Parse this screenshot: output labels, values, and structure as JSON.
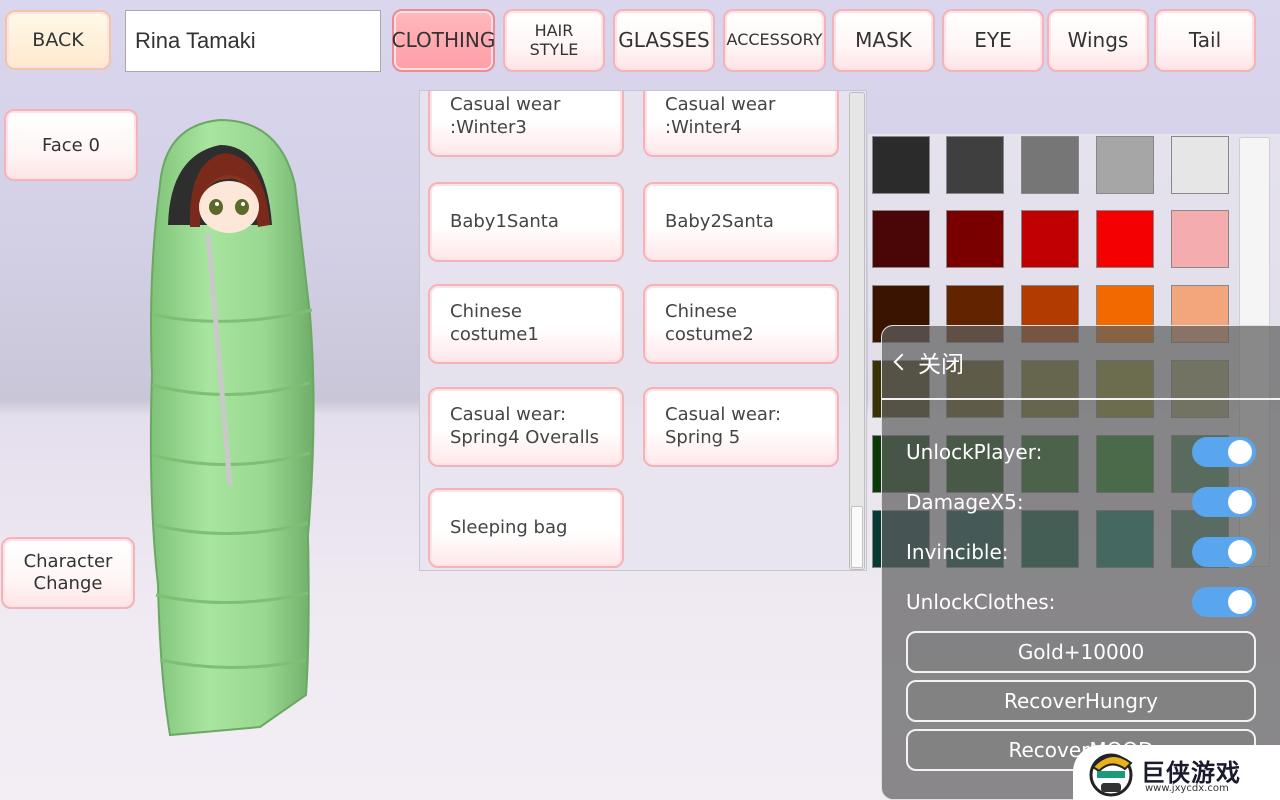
{
  "top_bar": {
    "back_label": "BACK",
    "name_value": "Rina Tamaki",
    "tabs": [
      {
        "label": "CLOTHING",
        "active": true
      },
      {
        "label": "HAIR\nSTYLE",
        "active": false
      },
      {
        "label": "GLASSES",
        "active": false
      },
      {
        "label": "ACCESSORY",
        "active": false
      },
      {
        "label": "MASK",
        "active": false
      },
      {
        "label": "EYE",
        "active": false
      },
      {
        "label": "Wings",
        "active": false
      },
      {
        "label": "Tail",
        "active": false
      }
    ]
  },
  "side": {
    "face_label": "Face 0",
    "character_change_label": "Character\nChange"
  },
  "clothing_list": [
    "Casual wear\n:Winter3",
    "Casual wear\n:Winter4",
    "Baby1Santa",
    "Baby2Santa",
    "Chinese costume1",
    "Chinese costume2",
    "Casual wear:\nSpring4 Overalls",
    "Casual wear:\nSpring 5",
    "Sleeping bag"
  ],
  "palette": [
    [
      "#2b2b2b",
      "#3f3f3f",
      "#767676",
      "#a6a6a6",
      "#e6e6e6"
    ],
    [
      "#4a0606",
      "#7a0000",
      "#c00000",
      "#f50000",
      "#f4acae"
    ],
    [
      "#3b1400",
      "#622400",
      "#b23c00",
      "#f06a00",
      "#f3a57c"
    ],
    [
      "#3a3206",
      "#5a520f",
      "#767624",
      "#8c8e22",
      "#a3a56a"
    ],
    [
      "#0a3a08",
      "#0d4e0a",
      "#1a6a12",
      "#128a12",
      "#4a8a52"
    ],
    [
      "#063a32",
      "#004a3e",
      "#005a3a",
      "#008060",
      "#4a8a6a"
    ]
  ],
  "cheat_menu": {
    "close_label": "关闭",
    "toggles": [
      {
        "label": "UnlockPlayer:",
        "on": true
      },
      {
        "label": "DamageX5:",
        "on": true
      },
      {
        "label": "Invincible:",
        "on": true
      },
      {
        "label": "UnlockClothes:",
        "on": true
      }
    ],
    "buttons": [
      "Gold+10000",
      "RecoverHungry",
      "RecoverMOOD"
    ]
  },
  "watermark": {
    "brand": "巨侠游戏",
    "url": "www.jxycdx.com"
  },
  "colors": {
    "accent_pink": "#ff9ea6",
    "toggle_blue": "#5aa6ee",
    "bag_green": "#9fdd97"
  }
}
